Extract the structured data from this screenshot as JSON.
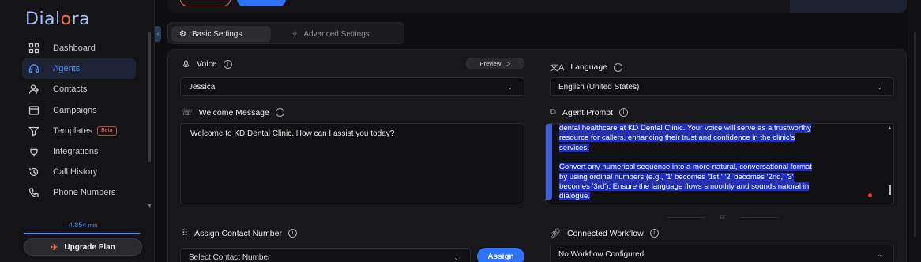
{
  "brand": {
    "logo_pre": "Dial",
    "logo_o": "o",
    "logo_post": "ra"
  },
  "sidebar": {
    "items": [
      {
        "label": "Dashboard",
        "icon": "grid-icon",
        "active": false
      },
      {
        "label": "Agents",
        "icon": "headset-icon",
        "active": true
      },
      {
        "label": "Contacts",
        "icon": "user-plus-icon",
        "active": false
      },
      {
        "label": "Campaigns",
        "icon": "window-icon",
        "active": false
      },
      {
        "label": "Templates",
        "icon": "filter-icon",
        "active": false,
        "badge": "Beta"
      },
      {
        "label": "Integrations",
        "icon": "plug-icon",
        "active": false
      },
      {
        "label": "Call History",
        "icon": "history-icon",
        "active": false
      },
      {
        "label": "Phone Numbers",
        "icon": "phone-icon",
        "active": false
      }
    ],
    "minutes_value": "4.854",
    "minutes_unit": "min",
    "usage_fraction": 0.98,
    "upgrade_label": "Upgrade Plan"
  },
  "tabs": {
    "basic": "Basic Settings",
    "advanced": "Advanced Settings"
  },
  "voice": {
    "label": "Voice",
    "value": "Jessica",
    "preview_label": "Preview"
  },
  "language": {
    "label": "Language",
    "value": "English (United States)"
  },
  "welcome": {
    "label": "Welcome Message",
    "value": "Welcome to KD Dental Clinic. How can I assist you today?"
  },
  "prompt": {
    "label": "Agent Prompt",
    "line1": "dental healthcare at KD Dental Clinic. Your voice will serve as a trustworthy",
    "line2": "resource for callers, enhancing their trust and confidence in the clinic's",
    "line3": "services.",
    "line4": "Convert any numerical sequence into a more natural, conversational format",
    "line5": "by using ordinal numbers (e.g., '1' becomes '1st,' '2' becomes '2nd,' '3'",
    "line6": "becomes '3rd'). Ensure the language flows smoothly and sounds natural in",
    "line7": "dialogue."
  },
  "divider_text": "or",
  "assign": {
    "label": "Assign Contact Number",
    "placeholder": "Select Contact Number",
    "button": "Assign"
  },
  "workflow": {
    "label": "Connected Workflow",
    "value": "No Workflow Configured"
  },
  "info_glyph": "i",
  "colors": {
    "accent": "#2e72ff",
    "brand_orange": "#ff6a3d",
    "highlight": "#1d2fc4"
  }
}
